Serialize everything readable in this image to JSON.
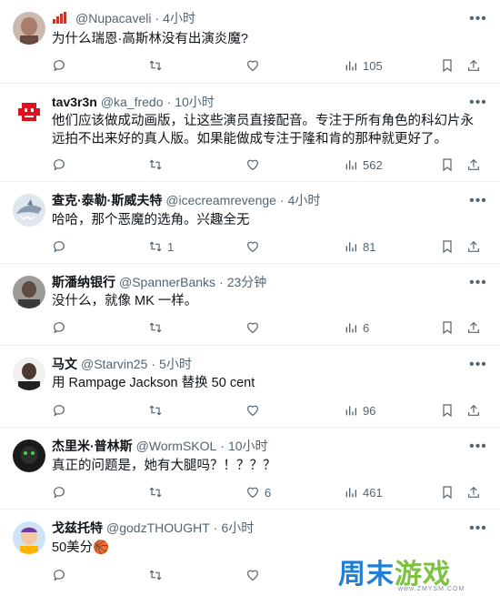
{
  "tweets": [
    {
      "name": "",
      "handle": "@Nupacaveli",
      "time": "4小时",
      "text": "为什么瑞恩·高斯林没有出演炎魔?",
      "replies": "",
      "retweets": "",
      "likes": "",
      "views": "105",
      "avatar_icon": "avatar-photo"
    },
    {
      "name": "tav3r3n",
      "handle": "@ka_fredo",
      "time": "10小时",
      "text": "他们应该做成动画版，让这些演员直接配音。专注于所有角色的科幻片永远拍不出来好的真人版。如果能做成专注于隆和肯的那种就更好了。",
      "replies": "",
      "retweets": "",
      "likes": "",
      "views": "562",
      "avatar_icon": "red-robot-avatar"
    },
    {
      "name": "查克·泰勒·斯威夫特",
      "handle": "@icecreamrevenge",
      "time": "4小时",
      "text": "哈哈，那个恶魔的选角。兴趣全无",
      "replies": "",
      "retweets": "1",
      "likes": "",
      "views": "81",
      "avatar_icon": "shark-avatar"
    },
    {
      "name": "斯潘纳银行",
      "handle": "@SpannerBanks",
      "time": "23分钟",
      "text": "没什么，就像 MK 一样。",
      "replies": "",
      "retweets": "",
      "likes": "",
      "views": "6",
      "avatar_icon": "avatar-photo"
    },
    {
      "name": "马文",
      "handle": "@Starvin25",
      "time": "5小时",
      "text": "用 Rampage Jackson 替换 50 cent",
      "replies": "",
      "retweets": "",
      "likes": "",
      "views": "96",
      "avatar_icon": "avatar-photo"
    },
    {
      "name": "杰里米·普林斯",
      "handle": "@WormSKOL",
      "time": "10小时",
      "text": "真正的问题是，她有大腿吗？！？？？",
      "replies": "",
      "retweets": "",
      "likes": "6",
      "views": "461",
      "avatar_icon": "dark-avatar"
    },
    {
      "name": "戈兹托特",
      "handle": "@godzTHOUGHT",
      "time": "6小时",
      "text": "50美分🏀",
      "replies": "",
      "retweets": "",
      "likes": "",
      "views": "",
      "avatar_icon": "cartoon-avatar"
    }
  ],
  "ui": {
    "dot": "·",
    "more": "•••"
  },
  "watermark": {
    "text_a": "周末",
    "text_b": "游戏",
    "url": "www.ZMYSM.COM"
  },
  "colors": {
    "secondary": "#536471",
    "divider": "#eff3f4",
    "watermark_blue": "#1f7fd6"
  }
}
